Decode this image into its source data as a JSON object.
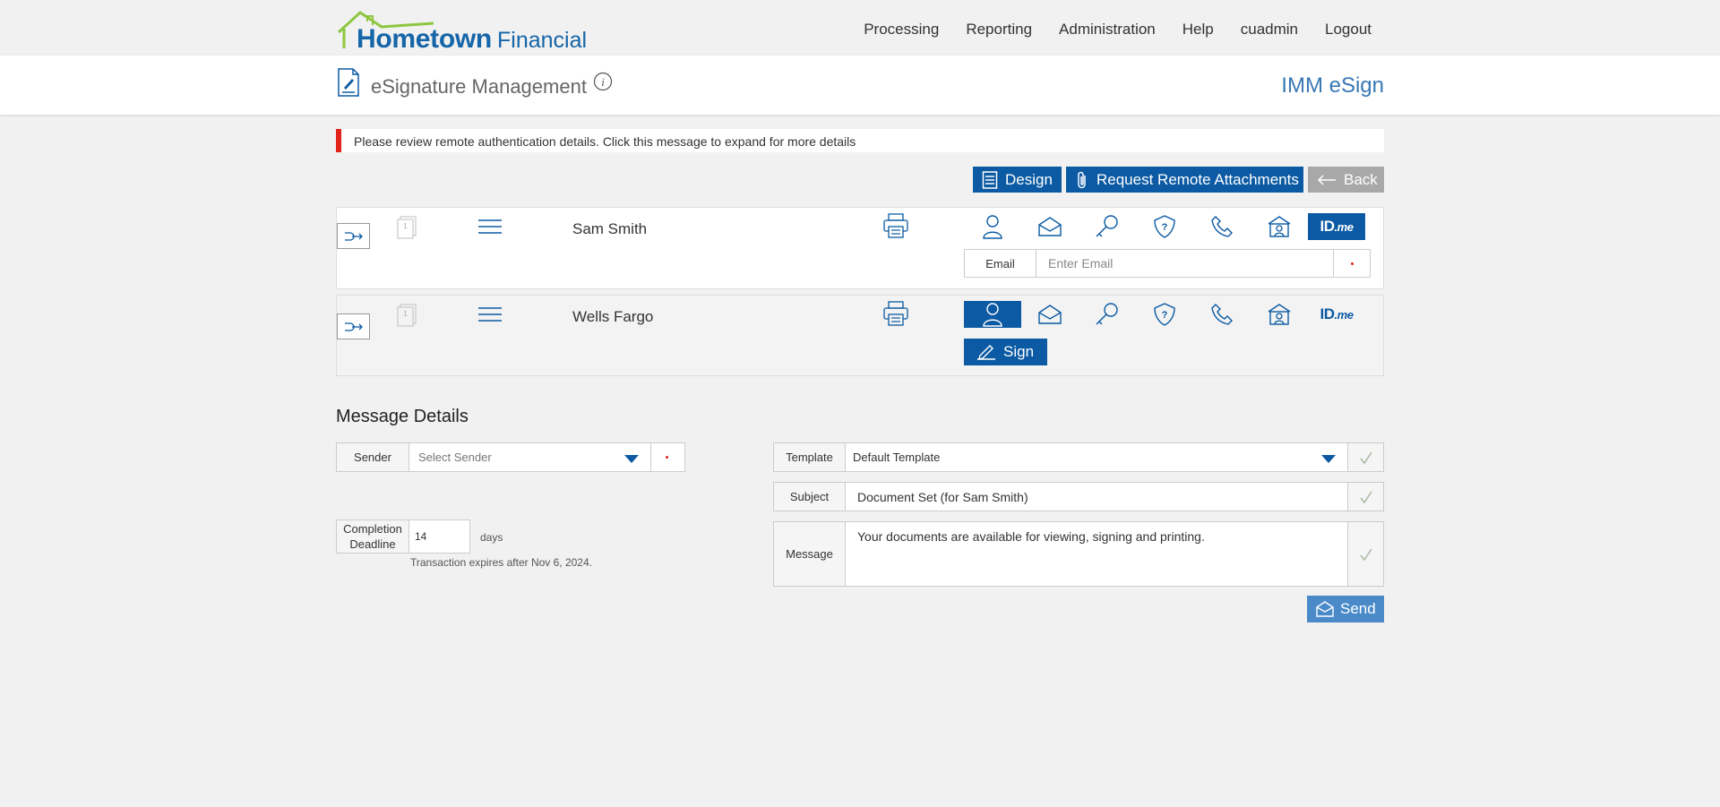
{
  "brand": {
    "name_bold": "Hometown",
    "name_light": "Financial"
  },
  "nav": {
    "items": [
      "Processing",
      "Reporting",
      "Administration",
      "Help",
      "cuadmin",
      "Logout"
    ]
  },
  "header": {
    "title": "eSignature Management",
    "app_name": "IMM eSign"
  },
  "alert": {
    "text": "Please review remote authentication details. Click this message to expand for more details"
  },
  "actions": {
    "design": "Design",
    "request_attachments": "Request Remote Attachments",
    "back": "Back"
  },
  "recipients": [
    {
      "name": "Sam Smith",
      "doc_count": "1",
      "email_label": "Email",
      "email_placeholder": "Enter Email",
      "email_value": "",
      "selected_auth": "idme"
    },
    {
      "name": "Wells Fargo",
      "doc_count": "1",
      "sign_label": "Sign",
      "selected_auth": "in-person"
    }
  ],
  "auth_methods": [
    "in-person-icon",
    "email-icon",
    "key-icon",
    "security-question-icon",
    "phone-icon",
    "kba-icon",
    "idme-icon"
  ],
  "idme": {
    "id": "ID",
    "me": ".me"
  },
  "message_details": {
    "title": "Message Details",
    "sender": {
      "label": "Sender",
      "placeholder": "Select Sender"
    },
    "completion": {
      "label": "Completion Deadline",
      "value": "14",
      "unit": "days",
      "note": "Transaction expires after Nov 6, 2024."
    },
    "template": {
      "label": "Template",
      "value": "Default Template"
    },
    "subject": {
      "label": "Subject",
      "value": "Document Set (for Sam Smith)"
    },
    "message": {
      "label": "Message",
      "value": "Your documents are available for viewing, signing and printing."
    },
    "send_label": "Send"
  },
  "colors": {
    "primary": "#0b5aa3",
    "accent_red": "#e2231a",
    "roof_green": "#8dc63f",
    "send": "#4a8ac9"
  }
}
